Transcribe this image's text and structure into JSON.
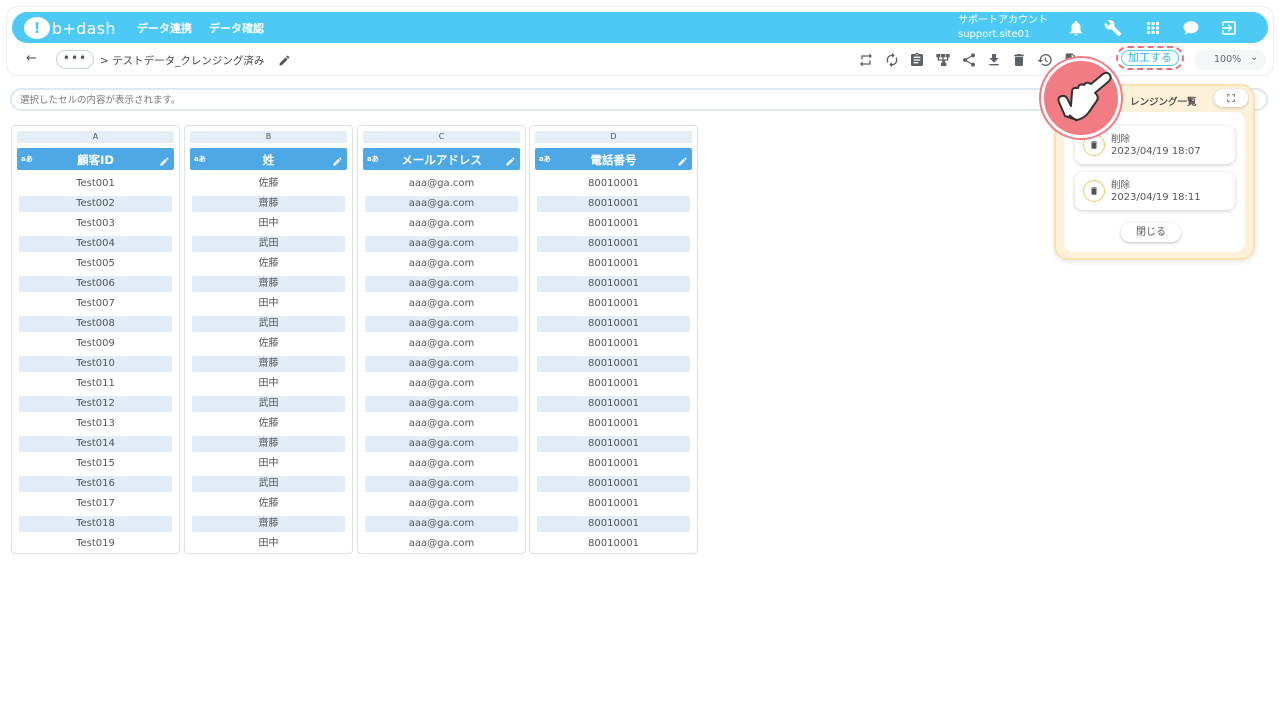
{
  "header": {
    "logo_text": "b+dash",
    "nav": [
      "データ連携",
      "データ確認"
    ],
    "account_name": "サポートアカウント",
    "account_id": "support.site01"
  },
  "breadcrumb": {
    "back_label": "←",
    "more_label": "•••",
    "path": "> テストデータ_クレンジング済み"
  },
  "toolbar": {
    "process_label": "加工する",
    "zoom_value": "100%"
  },
  "cellbar": {
    "placeholder": "選択したセルの内容が表示されます。"
  },
  "columns": [
    {
      "letter": "A",
      "type": "aあ",
      "title": "顧客ID",
      "cells": [
        "Test001",
        "Test002",
        "Test003",
        "Test004",
        "Test005",
        "Test006",
        "Test007",
        "Test008",
        "Test009",
        "Test010",
        "Test011",
        "Test012",
        "Test013",
        "Test014",
        "Test015",
        "Test016",
        "Test017",
        "Test018",
        "Test019"
      ]
    },
    {
      "letter": "B",
      "type": "aあ",
      "title": "姓",
      "cells": [
        "佐藤",
        "齋藤",
        "田中",
        "武田",
        "佐藤",
        "齋藤",
        "田中",
        "武田",
        "佐藤",
        "齋藤",
        "田中",
        "武田",
        "佐藤",
        "齋藤",
        "田中",
        "武田",
        "佐藤",
        "齋藤",
        "田中"
      ]
    },
    {
      "letter": "C",
      "type": "aあ",
      "title": "メールアドレス",
      "cells": [
        "aaa@ga.com",
        "aaa@ga.com",
        "aaa@ga.com",
        "aaa@ga.com",
        "aaa@ga.com",
        "aaa@ga.com",
        "aaa@ga.com",
        "aaa@ga.com",
        "aaa@ga.com",
        "aaa@ga.com",
        "aaa@ga.com",
        "aaa@ga.com",
        "aaa@ga.com",
        "aaa@ga.com",
        "aaa@ga.com",
        "aaa@ga.com",
        "aaa@ga.com",
        "aaa@ga.com",
        "aaa@ga.com"
      ]
    },
    {
      "letter": "D",
      "type": "aあ",
      "title": "電話番号",
      "cells": [
        "80010001",
        "80010001",
        "80010001",
        "80010001",
        "80010001",
        "80010001",
        "80010001",
        "80010001",
        "80010001",
        "80010001",
        "80010001",
        "80010001",
        "80010001",
        "80010001",
        "80010001",
        "80010001",
        "80010001",
        "80010001",
        "80010001"
      ]
    }
  ],
  "panel": {
    "title": "レンジング一覧",
    "history": [
      {
        "label": "削除",
        "time": "2023/04/19 18:07"
      },
      {
        "label": "削除",
        "time": "2023/04/19 18:11"
      }
    ],
    "close_label": "閉じる"
  },
  "colors": {
    "header_bg": "#4ccaf5",
    "column_header_bg": "#4ea8e6",
    "stripe_bg": "#e1ecf7",
    "highlight": "#f06b78",
    "panel_bg": "#fdf1d9"
  }
}
